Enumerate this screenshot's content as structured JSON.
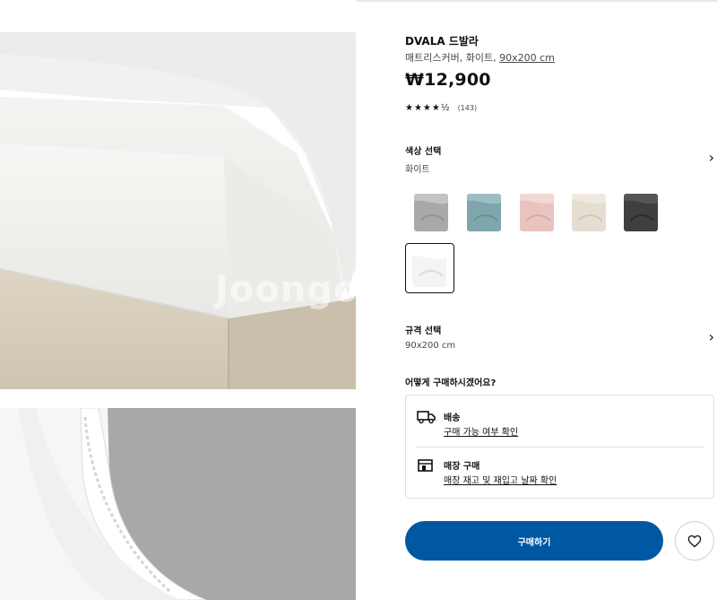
{
  "product": {
    "name": "DVALA 드발라",
    "description": "매트리스커버, 화이트,",
    "size_link": "90x200 cm",
    "price": "₩12,900",
    "rating_stars": "★★★★½",
    "rating_value": 4.5,
    "review_count": "(143)"
  },
  "color_select": {
    "title": "색상 선택",
    "value": "화이트",
    "swatches": [
      {
        "name": "gray",
        "color": "#a9a9a9"
      },
      {
        "name": "teal",
        "color": "#7fa6ad"
      },
      {
        "name": "pink",
        "color": "#e9c3bf"
      },
      {
        "name": "beige",
        "color": "#e5ddd1"
      },
      {
        "name": "dark-gray",
        "color": "#3d3f40"
      },
      {
        "name": "white",
        "color": "#f4f4f4",
        "selected": true
      }
    ]
  },
  "size_select": {
    "title": "규격 선택",
    "value": "90x200 cm"
  },
  "purchase": {
    "question": "어떻게 구매하시겠어요?",
    "delivery": {
      "title": "배송",
      "link": "구매 가능 여부 확인",
      "icon": "truck-icon"
    },
    "store": {
      "title": "매장 구매",
      "link": "매장 재고 및 재입고 날짜 확인",
      "icon": "store-icon"
    }
  },
  "actions": {
    "buy_label": "구매하기",
    "favorite_icon": "heart-icon"
  },
  "gallery": {
    "watermark": "Joongo"
  },
  "colors": {
    "accent": "#0058a3",
    "text": "#111111",
    "muted": "#484848",
    "border": "#dfdfdf"
  }
}
